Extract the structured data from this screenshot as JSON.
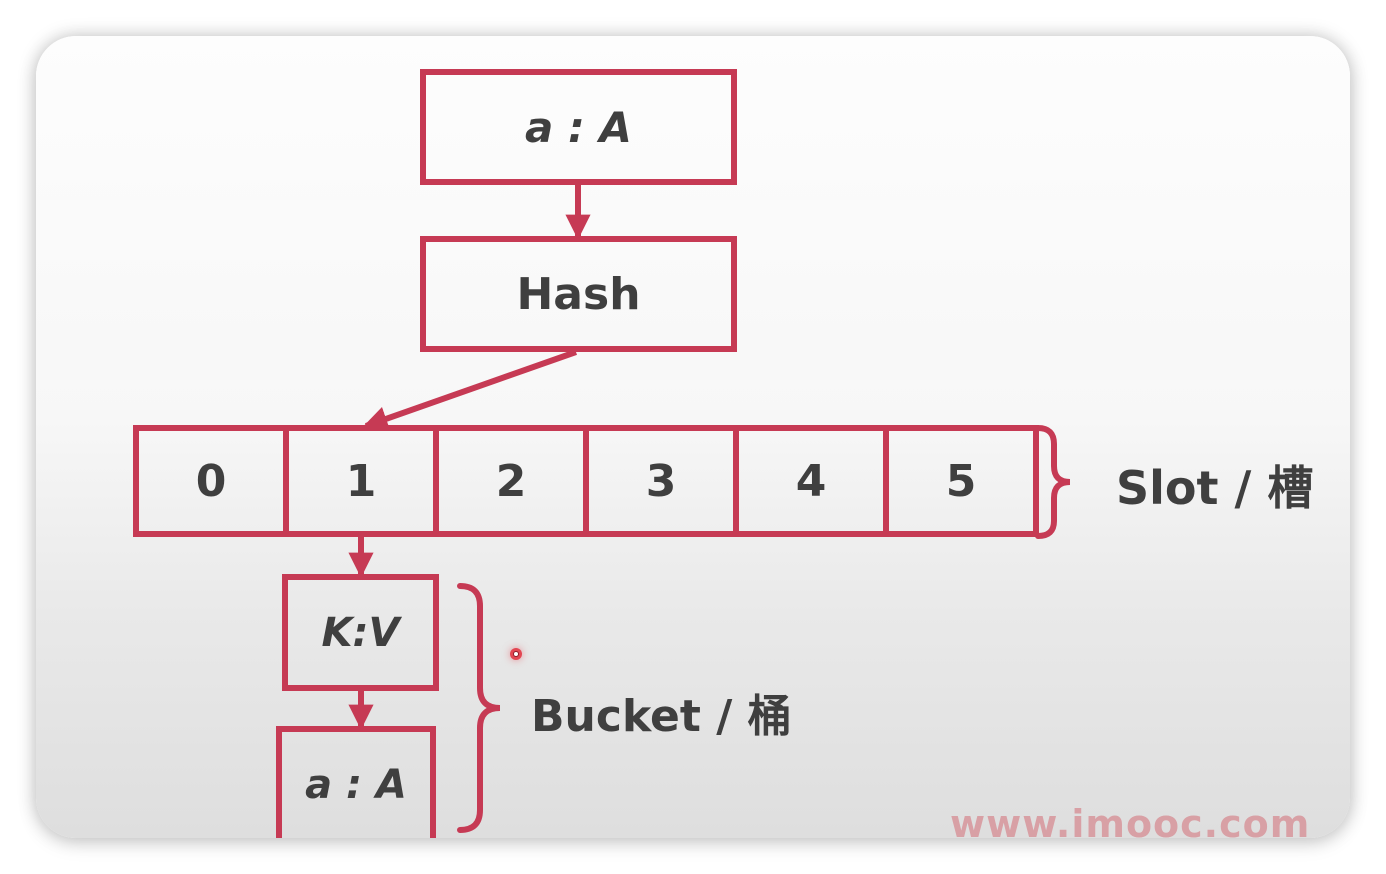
{
  "diagram": {
    "input_node": "a : A",
    "hash_node": "Hash",
    "slots": [
      "0",
      "1",
      "2",
      "3",
      "4",
      "5"
    ],
    "slot_label": "Slot / 槽",
    "bucket_entries": [
      "K:V",
      "a : A"
    ],
    "bucket_label": "Bucket / 桶"
  },
  "watermark": "www.imooc.com",
  "colors": {
    "accent": "#c63a54",
    "text": "#3f3f3f",
    "watermark": "#d89a9f"
  }
}
